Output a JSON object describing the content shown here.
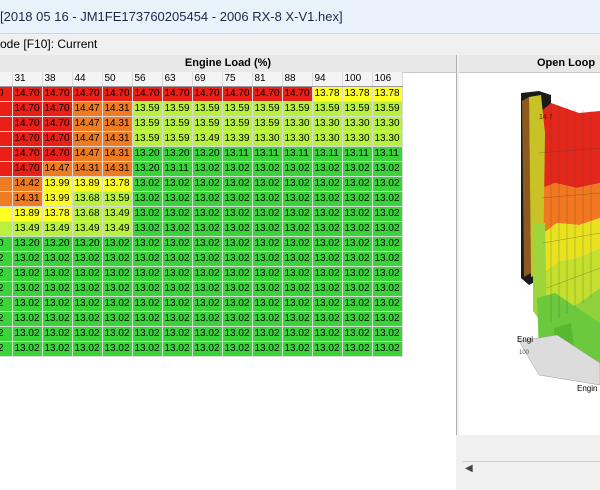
{
  "window": {
    "title": "[2018 05 16 - JM1FE173760205454 - 2006 RX-8 X-V1.hex]",
    "mode_text": "ode [F10]: Current"
  },
  "grid": {
    "header": "Engine Load (%)",
    "columns": [
      "",
      "31",
      "38",
      "44",
      "50",
      "56",
      "63",
      "69",
      "75",
      "81",
      "88",
      "94",
      "100",
      "106"
    ],
    "rows": [
      [
        "4.70",
        "14.70",
        "14.70",
        "14.70",
        "14.70",
        "14.70",
        "14.70",
        "14.70",
        "14.70",
        "14.70",
        "14.70",
        "13.78",
        "13.78",
        "13.78"
      ],
      [
        ".70",
        "14.70",
        "14.70",
        "14.47",
        "14.31",
        "13.59",
        "13.59",
        "13.59",
        "13.59",
        "13.59",
        "13.59",
        "13.59",
        "13.59",
        "13.59"
      ],
      [
        ".70",
        "14.70",
        "14.70",
        "14.47",
        "14.31",
        "13.59",
        "13.59",
        "13.59",
        "13.59",
        "13.59",
        "13.30",
        "13.30",
        "13.30",
        "13.30"
      ],
      [
        ".70",
        "14.70",
        "14.70",
        "14.47",
        "14.31",
        "13.59",
        "13.59",
        "13.49",
        "13.39",
        "13.30",
        "13.30",
        "13.30",
        "13.30",
        "13.30"
      ],
      [
        ".70",
        "14.70",
        "14.70",
        "14.47",
        "14.31",
        "13.20",
        "13.20",
        "13.20",
        "13.11",
        "13.11",
        "13.11",
        "13.11",
        "13.11",
        "13.11"
      ],
      [
        ".70",
        "14.70",
        "14.47",
        "14.31",
        "14.31",
        "13.20",
        "13.11",
        "13.02",
        "13.02",
        "13.02",
        "13.02",
        "13.02",
        "13.02",
        "13.02"
      ],
      [
        ".42",
        "14.42",
        "13.99",
        "13.89",
        "13.78",
        "13.02",
        "13.02",
        "13.02",
        "13.02",
        "13.02",
        "13.02",
        "13.02",
        "13.02",
        "13.02"
      ],
      [
        ".42",
        "14.31",
        "13.99",
        "13.68",
        "13.59",
        "13.02",
        "13.02",
        "13.02",
        "13.02",
        "13.02",
        "13.02",
        "13.02",
        "13.02",
        "13.02"
      ],
      [
        ".89",
        "13.89",
        "13.78",
        "13.68",
        "13.49",
        "13.02",
        "13.02",
        "13.02",
        "13.02",
        "13.02",
        "13.02",
        "13.02",
        "13.02",
        "13.02"
      ],
      [
        ".49",
        "13.49",
        "13.49",
        "13.49",
        "13.49",
        "13.02",
        "13.02",
        "13.02",
        "13.02",
        "13.02",
        "13.02",
        "13.02",
        "13.02",
        "13.02"
      ],
      [
        "3.20",
        "13.20",
        "13.20",
        "13.20",
        "13.02",
        "13.02",
        "13.02",
        "13.02",
        "13.02",
        "13.02",
        "13.02",
        "13.02",
        "13.02",
        "13.02"
      ],
      [
        "3.02",
        "13.02",
        "13.02",
        "13.02",
        "13.02",
        "13.02",
        "13.02",
        "13.02",
        "13.02",
        "13.02",
        "13.02",
        "13.02",
        "13.02",
        "13.02"
      ],
      [
        "3.02",
        "13.02",
        "13.02",
        "13.02",
        "13.02",
        "13.02",
        "13.02",
        "13.02",
        "13.02",
        "13.02",
        "13.02",
        "13.02",
        "13.02",
        "13.02"
      ],
      [
        "3.02",
        "13.02",
        "13.02",
        "13.02",
        "13.02",
        "13.02",
        "13.02",
        "13.02",
        "13.02",
        "13.02",
        "13.02",
        "13.02",
        "13.02",
        "13.02"
      ],
      [
        "3.02",
        "13.02",
        "13.02",
        "13.02",
        "13.02",
        "13.02",
        "13.02",
        "13.02",
        "13.02",
        "13.02",
        "13.02",
        "13.02",
        "13.02",
        "13.02"
      ],
      [
        "3.02",
        "13.02",
        "13.02",
        "13.02",
        "13.02",
        "13.02",
        "13.02",
        "13.02",
        "13.02",
        "13.02",
        "13.02",
        "13.02",
        "13.02",
        "13.02"
      ],
      [
        "3.02",
        "13.02",
        "13.02",
        "13.02",
        "13.02",
        "13.02",
        "13.02",
        "13.02",
        "13.02",
        "13.02",
        "13.02",
        "13.02",
        "13.02",
        "13.02"
      ],
      [
        "3.02",
        "13.02",
        "13.02",
        "13.02",
        "13.02",
        "13.02",
        "13.02",
        "13.02",
        "13.02",
        "13.02",
        "13.02",
        "13.02",
        "13.02",
        "13.02"
      ]
    ],
    "color_scale": {
      "red": "#e82017",
      "orange": "#f07c22",
      "yellow": "#ffff22",
      "light_green": "#b8f23c",
      "green": "#38d438"
    }
  },
  "plot": {
    "header": "Open Loop",
    "peak_label": "14.7",
    "axis_label_1": "Engi",
    "axis_label_2": "Engin",
    "tick_label": "100"
  }
}
